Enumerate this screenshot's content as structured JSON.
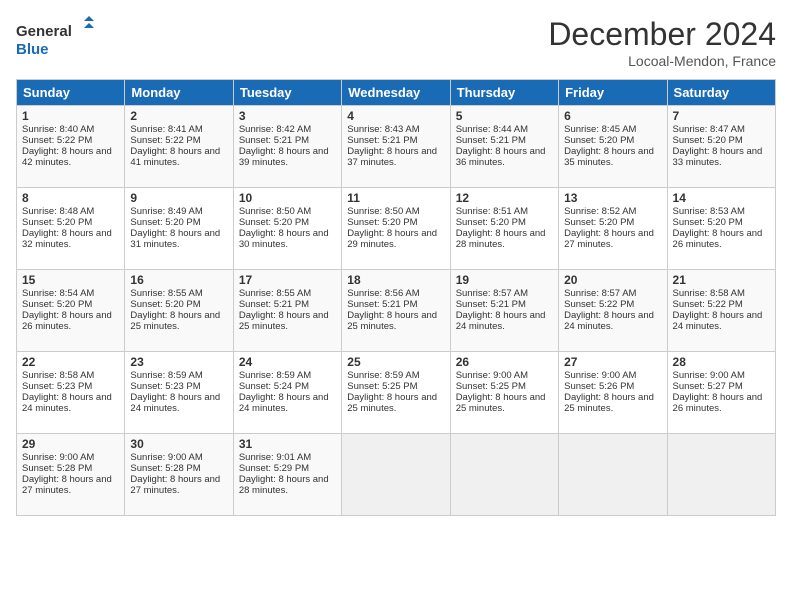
{
  "header": {
    "logo_line1": "General",
    "logo_line2": "Blue",
    "month": "December 2024",
    "location": "Locoal-Mendon, France"
  },
  "days_of_week": [
    "Sunday",
    "Monday",
    "Tuesday",
    "Wednesday",
    "Thursday",
    "Friday",
    "Saturday"
  ],
  "weeks": [
    [
      {
        "day": "1",
        "sunrise": "Sunrise: 8:40 AM",
        "sunset": "Sunset: 5:22 PM",
        "daylight": "Daylight: 8 hours and 42 minutes."
      },
      {
        "day": "2",
        "sunrise": "Sunrise: 8:41 AM",
        "sunset": "Sunset: 5:22 PM",
        "daylight": "Daylight: 8 hours and 41 minutes."
      },
      {
        "day": "3",
        "sunrise": "Sunrise: 8:42 AM",
        "sunset": "Sunset: 5:21 PM",
        "daylight": "Daylight: 8 hours and 39 minutes."
      },
      {
        "day": "4",
        "sunrise": "Sunrise: 8:43 AM",
        "sunset": "Sunset: 5:21 PM",
        "daylight": "Daylight: 8 hours and 37 minutes."
      },
      {
        "day": "5",
        "sunrise": "Sunrise: 8:44 AM",
        "sunset": "Sunset: 5:21 PM",
        "daylight": "Daylight: 8 hours and 36 minutes."
      },
      {
        "day": "6",
        "sunrise": "Sunrise: 8:45 AM",
        "sunset": "Sunset: 5:20 PM",
        "daylight": "Daylight: 8 hours and 35 minutes."
      },
      {
        "day": "7",
        "sunrise": "Sunrise: 8:47 AM",
        "sunset": "Sunset: 5:20 PM",
        "daylight": "Daylight: 8 hours and 33 minutes."
      }
    ],
    [
      {
        "day": "8",
        "sunrise": "Sunrise: 8:48 AM",
        "sunset": "Sunset: 5:20 PM",
        "daylight": "Daylight: 8 hours and 32 minutes."
      },
      {
        "day": "9",
        "sunrise": "Sunrise: 8:49 AM",
        "sunset": "Sunset: 5:20 PM",
        "daylight": "Daylight: 8 hours and 31 minutes."
      },
      {
        "day": "10",
        "sunrise": "Sunrise: 8:50 AM",
        "sunset": "Sunset: 5:20 PM",
        "daylight": "Daylight: 8 hours and 30 minutes."
      },
      {
        "day": "11",
        "sunrise": "Sunrise: 8:50 AM",
        "sunset": "Sunset: 5:20 PM",
        "daylight": "Daylight: 8 hours and 29 minutes."
      },
      {
        "day": "12",
        "sunrise": "Sunrise: 8:51 AM",
        "sunset": "Sunset: 5:20 PM",
        "daylight": "Daylight: 8 hours and 28 minutes."
      },
      {
        "day": "13",
        "sunrise": "Sunrise: 8:52 AM",
        "sunset": "Sunset: 5:20 PM",
        "daylight": "Daylight: 8 hours and 27 minutes."
      },
      {
        "day": "14",
        "sunrise": "Sunrise: 8:53 AM",
        "sunset": "Sunset: 5:20 PM",
        "daylight": "Daylight: 8 hours and 26 minutes."
      }
    ],
    [
      {
        "day": "15",
        "sunrise": "Sunrise: 8:54 AM",
        "sunset": "Sunset: 5:20 PM",
        "daylight": "Daylight: 8 hours and 26 minutes."
      },
      {
        "day": "16",
        "sunrise": "Sunrise: 8:55 AM",
        "sunset": "Sunset: 5:20 PM",
        "daylight": "Daylight: 8 hours and 25 minutes."
      },
      {
        "day": "17",
        "sunrise": "Sunrise: 8:55 AM",
        "sunset": "Sunset: 5:21 PM",
        "daylight": "Daylight: 8 hours and 25 minutes."
      },
      {
        "day": "18",
        "sunrise": "Sunrise: 8:56 AM",
        "sunset": "Sunset: 5:21 PM",
        "daylight": "Daylight: 8 hours and 25 minutes."
      },
      {
        "day": "19",
        "sunrise": "Sunrise: 8:57 AM",
        "sunset": "Sunset: 5:21 PM",
        "daylight": "Daylight: 8 hours and 24 minutes."
      },
      {
        "day": "20",
        "sunrise": "Sunrise: 8:57 AM",
        "sunset": "Sunset: 5:22 PM",
        "daylight": "Daylight: 8 hours and 24 minutes."
      },
      {
        "day": "21",
        "sunrise": "Sunrise: 8:58 AM",
        "sunset": "Sunset: 5:22 PM",
        "daylight": "Daylight: 8 hours and 24 minutes."
      }
    ],
    [
      {
        "day": "22",
        "sunrise": "Sunrise: 8:58 AM",
        "sunset": "Sunset: 5:23 PM",
        "daylight": "Daylight: 8 hours and 24 minutes."
      },
      {
        "day": "23",
        "sunrise": "Sunrise: 8:59 AM",
        "sunset": "Sunset: 5:23 PM",
        "daylight": "Daylight: 8 hours and 24 minutes."
      },
      {
        "day": "24",
        "sunrise": "Sunrise: 8:59 AM",
        "sunset": "Sunset: 5:24 PM",
        "daylight": "Daylight: 8 hours and 24 minutes."
      },
      {
        "day": "25",
        "sunrise": "Sunrise: 8:59 AM",
        "sunset": "Sunset: 5:25 PM",
        "daylight": "Daylight: 8 hours and 25 minutes."
      },
      {
        "day": "26",
        "sunrise": "Sunrise: 9:00 AM",
        "sunset": "Sunset: 5:25 PM",
        "daylight": "Daylight: 8 hours and 25 minutes."
      },
      {
        "day": "27",
        "sunrise": "Sunrise: 9:00 AM",
        "sunset": "Sunset: 5:26 PM",
        "daylight": "Daylight: 8 hours and 25 minutes."
      },
      {
        "day": "28",
        "sunrise": "Sunrise: 9:00 AM",
        "sunset": "Sunset: 5:27 PM",
        "daylight": "Daylight: 8 hours and 26 minutes."
      }
    ],
    [
      {
        "day": "29",
        "sunrise": "Sunrise: 9:00 AM",
        "sunset": "Sunset: 5:28 PM",
        "daylight": "Daylight: 8 hours and 27 minutes."
      },
      {
        "day": "30",
        "sunrise": "Sunrise: 9:00 AM",
        "sunset": "Sunset: 5:28 PM",
        "daylight": "Daylight: 8 hours and 27 minutes."
      },
      {
        "day": "31",
        "sunrise": "Sunrise: 9:01 AM",
        "sunset": "Sunset: 5:29 PM",
        "daylight": "Daylight: 8 hours and 28 minutes."
      },
      null,
      null,
      null,
      null
    ]
  ]
}
